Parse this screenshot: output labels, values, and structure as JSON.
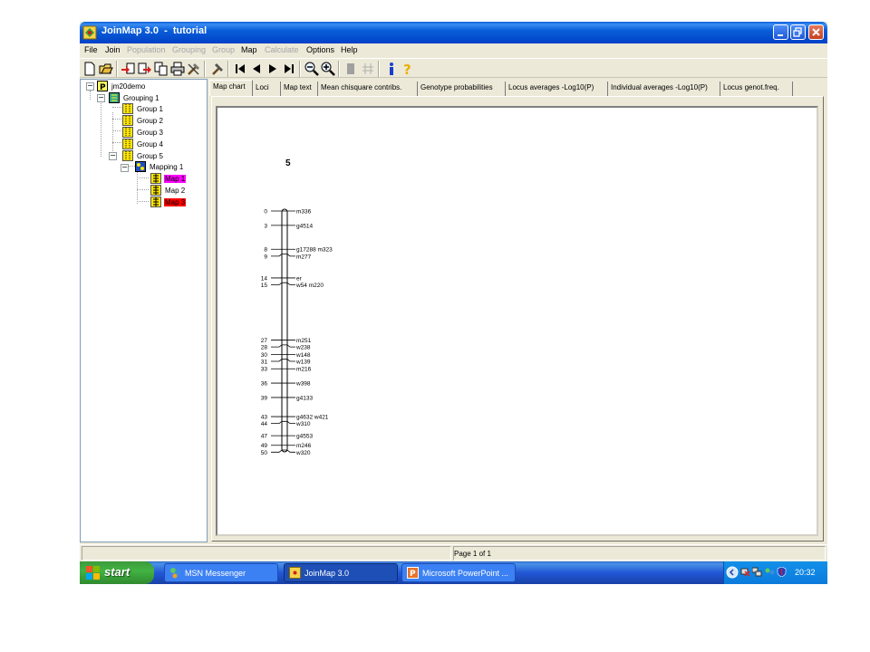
{
  "window": {
    "title": "JoinMap 3.0  -  tutorial"
  },
  "menu": [
    {
      "label": "File",
      "enabled": true
    },
    {
      "label": "Join",
      "enabled": true
    },
    {
      "label": "Population",
      "enabled": false
    },
    {
      "label": "Grouping",
      "enabled": false
    },
    {
      "label": "Group",
      "enabled": false
    },
    {
      "label": "Map",
      "enabled": true
    },
    {
      "label": "Calculate",
      "enabled": false
    },
    {
      "label": "Options",
      "enabled": true
    },
    {
      "label": "Help",
      "enabled": true
    }
  ],
  "toolbar": {
    "buttons": [
      "new-icon",
      "open-icon",
      "import-icon",
      "export-icon",
      "copy-icon",
      "print-icon",
      "tools-icon",
      "hammer-icon",
      "first-icon",
      "previous-icon",
      "next-icon",
      "last-icon",
      "zoom-out-icon",
      "zoom-in-icon",
      "fill-icon",
      "grid-icon",
      "info-icon",
      "help-icon"
    ]
  },
  "tree": {
    "root": "jm20demo",
    "grouping": "Grouping 1",
    "groups": [
      "Group 1",
      "Group 2",
      "Group 3",
      "Group 4",
      "Group 5"
    ],
    "mapping": "Mapping 1",
    "maps": [
      {
        "label": "Map 1",
        "highlight": "#ff00ff"
      },
      {
        "label": "Map 2",
        "highlight": ""
      },
      {
        "label": "Map 3",
        "highlight": "#ff0000"
      }
    ]
  },
  "tabs": [
    "Map chart",
    "Loci",
    "Map text",
    "Mean chisquare contribs.",
    "Genotype probabilities",
    "Locus averages -Log10(P)",
    "Individual averages -Log10(P)",
    "Locus genot.freq."
  ],
  "chart_data": {
    "type": "linkage-map",
    "title": "5",
    "loci": [
      {
        "pos": 0,
        "label": "m336"
      },
      {
        "pos": 3,
        "label": "g4514"
      },
      {
        "pos": 8,
        "label": "g17288 m323"
      },
      {
        "pos": 9,
        "label": "m277"
      },
      {
        "pos": 14,
        "label": "er"
      },
      {
        "pos": 15,
        "label": "w54 m220"
      },
      {
        "pos": 27,
        "label": "m251"
      },
      {
        "pos": 28,
        "label": "w238"
      },
      {
        "pos": 30,
        "label": "w148"
      },
      {
        "pos": 31,
        "label": "w139"
      },
      {
        "pos": 33,
        "label": "m216"
      },
      {
        "pos": 36,
        "label": "w398"
      },
      {
        "pos": 39,
        "label": "g4133"
      },
      {
        "pos": 43,
        "label": "g4632 w421"
      },
      {
        "pos": 44,
        "label": "w310"
      },
      {
        "pos": 47,
        "label": "g4553"
      },
      {
        "pos": 49,
        "label": "m246"
      },
      {
        "pos": 50,
        "label": "w320"
      }
    ]
  },
  "status": {
    "page": "Page 1 of 1"
  },
  "taskbar": {
    "start": "start",
    "tasks": [
      {
        "label": "MSN Messenger",
        "active": false
      },
      {
        "label": "JoinMap 3.0",
        "active": true
      },
      {
        "label": "Microsoft PowerPoint ...",
        "active": false
      }
    ],
    "clock": "20:32"
  },
  "colors": {
    "title_bar": "#0a5ed8",
    "taskbar": "#2157d7",
    "start_button": "#3c9a3c",
    "map1": "#ff00ff",
    "map3": "#ff0000"
  }
}
